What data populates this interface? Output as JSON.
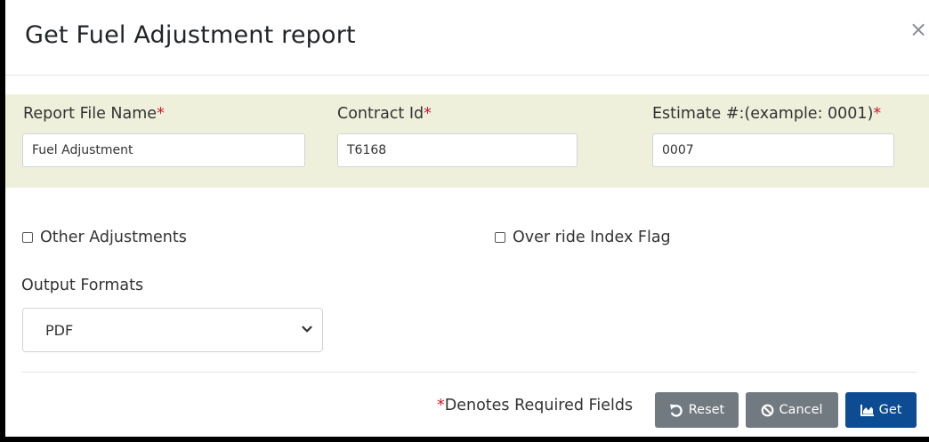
{
  "dialog": {
    "title": "Get Fuel Adjustment report",
    "close_glyph": "×"
  },
  "fields": {
    "report_file_name": {
      "label": "Report File Name",
      "required_mark": "*",
      "value": "Fuel Adjustment"
    },
    "contract_id": {
      "label": "Contract Id",
      "required_mark": "*",
      "value": "T6168"
    },
    "estimate": {
      "label": "Estimate #:(example: 0001)",
      "required_mark": "*",
      "value": "0007"
    }
  },
  "options": {
    "other_adjustments": {
      "label": "Other Adjustments",
      "checked": false
    },
    "override_index_flag": {
      "label": "Over ride Index Flag",
      "checked": false
    }
  },
  "output_formats": {
    "label": "Output Formats",
    "selected": "PDF"
  },
  "footer": {
    "required_mark": "*",
    "required_note": "Denotes Required Fields",
    "buttons": {
      "reset": "Reset",
      "cancel": "Cancel",
      "get": "Get"
    }
  },
  "colors": {
    "primary": "#0d4b93",
    "secondary": "#717a81",
    "required": "#d11a2a",
    "section_bg": "#eff0dc"
  },
  "icons": {
    "reset": "undo-icon",
    "cancel": "ban-icon",
    "get": "chart-area-icon",
    "select": "chevron-down-icon",
    "close": "close-icon"
  }
}
